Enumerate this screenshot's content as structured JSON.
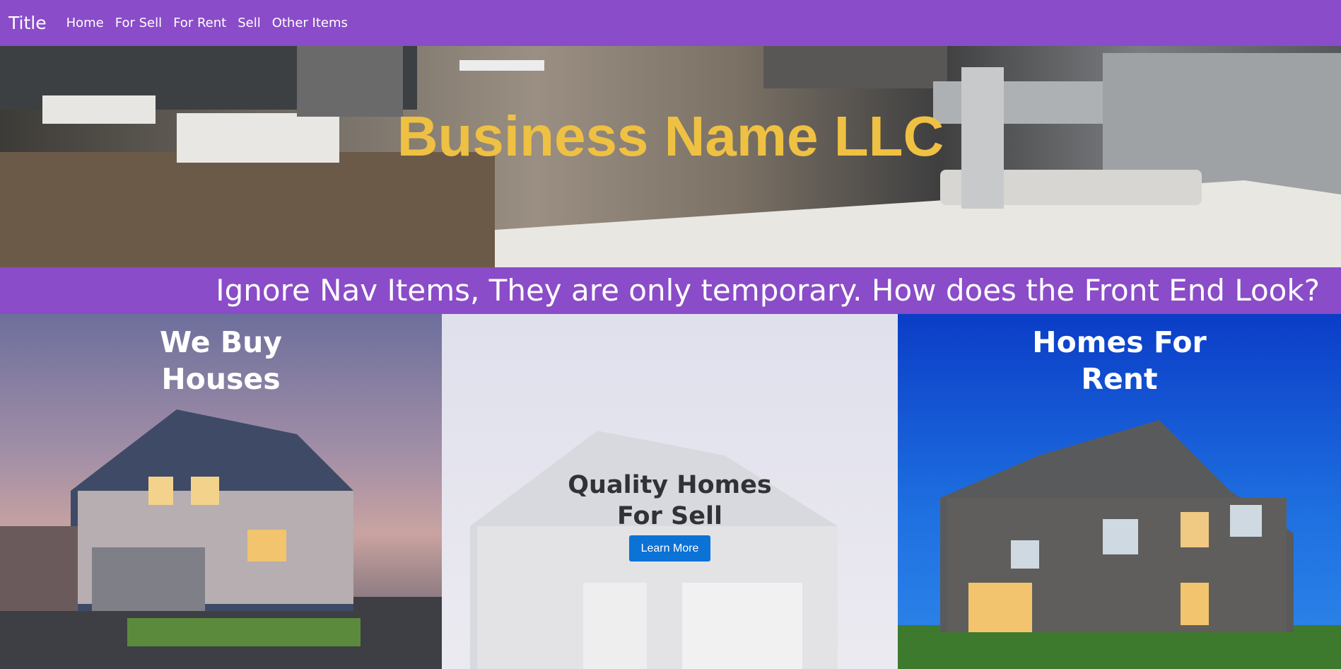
{
  "navbar": {
    "brand": "Title",
    "items": [
      {
        "label": "Home"
      },
      {
        "label": "For Sell"
      },
      {
        "label": "For Rent"
      },
      {
        "label": "Sell"
      },
      {
        "label": "Other Items"
      }
    ]
  },
  "hero": {
    "title": "Business Name LLC"
  },
  "tagline": "Ignore Nav Items, They are only temporary. How does the Front End Look?",
  "panels": {
    "buy": {
      "line1": "We Buy",
      "line2": "Houses"
    },
    "sell": {
      "line1": "Quality Homes",
      "line2": "For Sell",
      "button": "Learn More"
    },
    "rent": {
      "line1": "Homes For",
      "line2": "Rent"
    }
  },
  "colors": {
    "nav_purple": "#8a4cc8",
    "title_gold": "#efc143",
    "button_blue": "#0b72d6"
  }
}
